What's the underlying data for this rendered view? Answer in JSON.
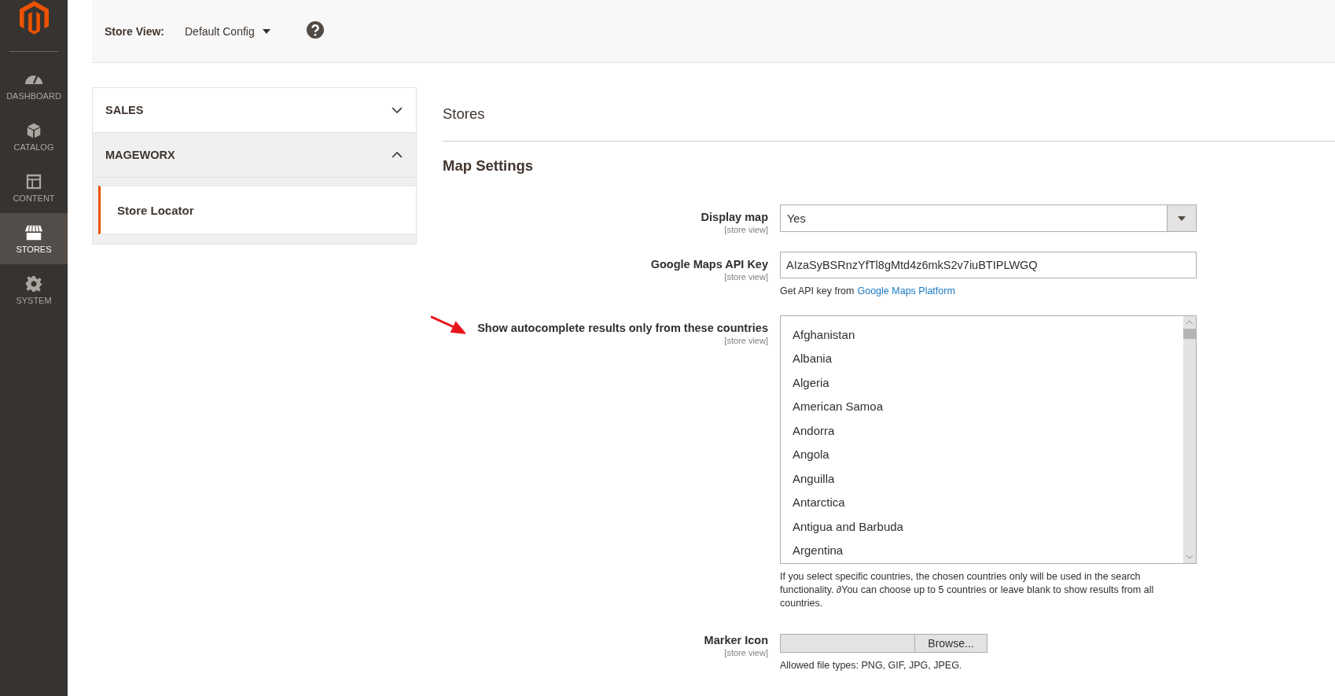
{
  "nav": [
    {
      "label": "DASHBOARD",
      "selected": false
    },
    {
      "label": "CATALOG",
      "selected": false
    },
    {
      "label": "CONTENT",
      "selected": false
    },
    {
      "label": "STORES",
      "selected": true
    },
    {
      "label": "SYSTEM",
      "selected": false
    }
  ],
  "scope": {
    "label": "Store View:",
    "value": "Default Config"
  },
  "config_tabs": [
    {
      "label": "SALES",
      "expanded": false
    },
    {
      "label": "MAGEWORX",
      "expanded": true,
      "items": [
        {
          "label": "Store Locator",
          "selected": true
        }
      ]
    }
  ],
  "section_title": "Stores",
  "group_title": "Map Settings",
  "fields": [
    {
      "kind": "select",
      "label": "Display map",
      "scope": "[store view]",
      "value": "Yes"
    },
    {
      "kind": "text",
      "label": "Google Maps API Key",
      "scope": "[store view]",
      "value": "AIzaSyBSRnzYfTl8gMtd4z6mkS2v7iuBTIPLWGQ",
      "note": "Get API key from",
      "link": "Google Maps Platform"
    },
    {
      "kind": "multiselect",
      "label": "Show autocomplete results only from these countries",
      "scope": "[store view]",
      "annotated": true,
      "options": [
        "Afghanistan",
        "Albania",
        "Algeria",
        "American Samoa",
        "Andorra",
        "Angola",
        "Anguilla",
        "Antarctica",
        "Antigua and Barbuda",
        "Argentina"
      ],
      "note": "If you select specific countries, the chosen countries only will be used in the search functionality. ∂You can choose up to 5 countries or leave blank to show results from all countries."
    },
    {
      "kind": "file",
      "label": "Marker Icon",
      "scope": "[store view]",
      "button": "Browse...",
      "note": "Allowed file types: PNG, GIF, JPG, JPEG."
    }
  ]
}
